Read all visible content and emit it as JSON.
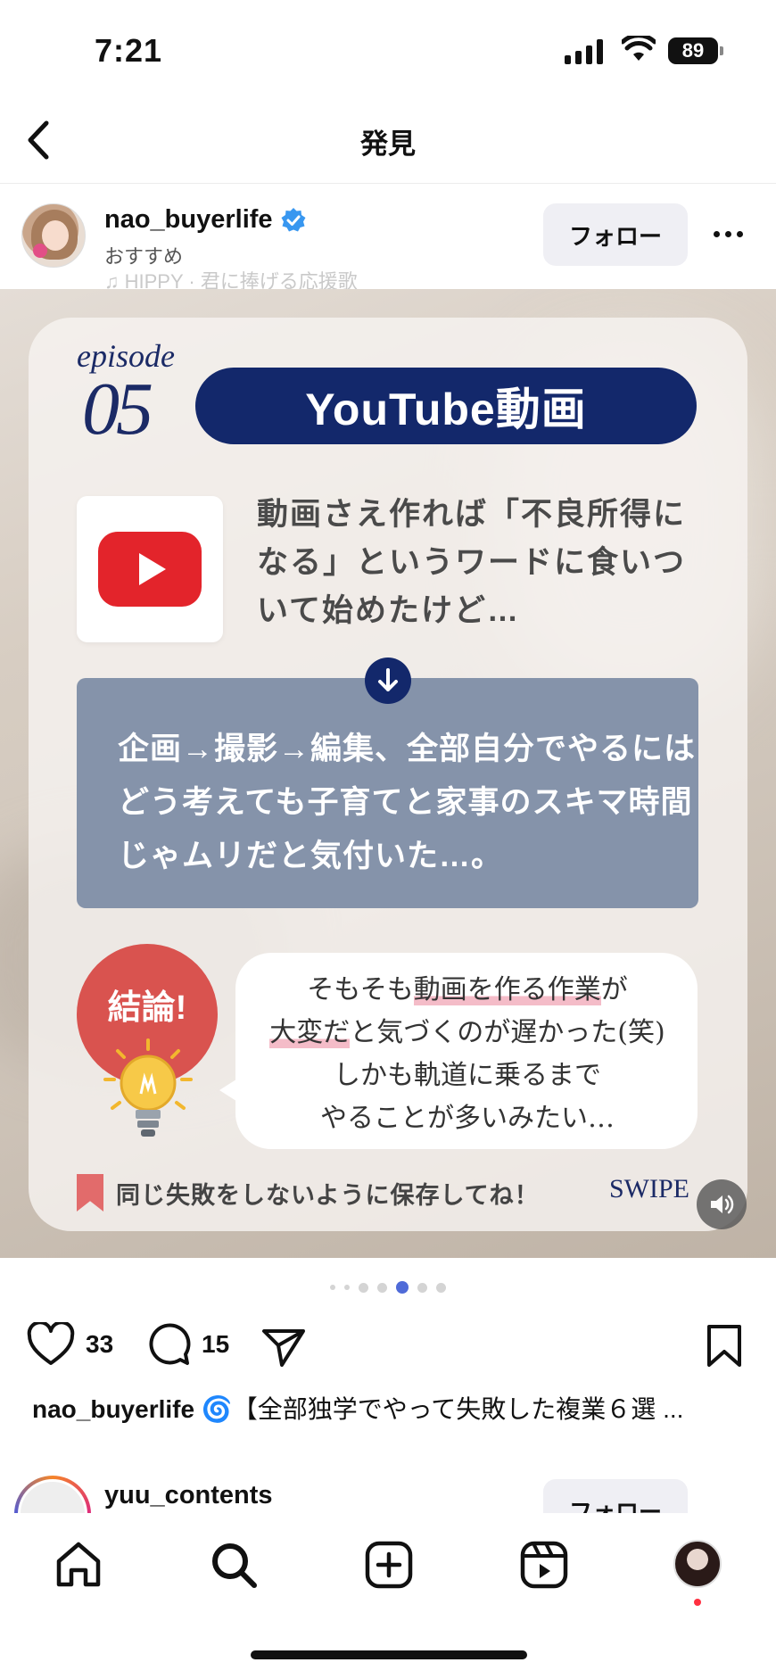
{
  "status_bar": {
    "time": "7:21",
    "battery": "89"
  },
  "nav": {
    "title": "発見"
  },
  "post": {
    "username": "nao_buyerlife",
    "subtitle": "おすすめ",
    "music": "♫ HIPPY · 君に捧げる応援歌",
    "follow_label": "フォロー",
    "image": {
      "episode_word": "episode",
      "episode_num": "05",
      "pill_title": "YouTube動画",
      "desc": "動画さえ作れば「不良所得になる」というワードに食いついて始めたけど…",
      "box_text": "企画→撮影→編集、全部自分でやるにはどう考えても子育てと家事のスキマ時間じゃムリだと気付いた…。",
      "conclusion": "結論!",
      "bubble_line1_a": "そもそも",
      "bubble_line1_hl": "動画を作る作業",
      "bubble_line1_b": "が",
      "bubble_line2_hl": "大変だ",
      "bubble_line2_b": "と気づくのが遅かった(笑)",
      "bubble_line3": "しかも軌道に乗るまで",
      "bubble_line4": "やることが多いみたい…",
      "save_note": "同じ失敗をしないように保存してね！",
      "swipe": "SWIPE"
    },
    "likes": "33",
    "comments": "15",
    "caption_user": "nao_buyerlife",
    "caption_text": " 🌀【全部独学でやって失敗した複業６選 ..."
  },
  "carousel": {
    "total": 7,
    "active_index": 4
  },
  "next_post": {
    "username": "yuu_contents",
    "follow_label": "フォロー"
  },
  "colors": {
    "navy": "#13286b",
    "youtube_red": "#e3242b",
    "box_gray_blue": "#8593aa",
    "conclusion_red": "#d9534f",
    "carousel_active": "#4f6bd8"
  },
  "icons": {
    "back": "chevron-left-icon",
    "verified": "verified-badge-icon",
    "more": "more-horizontal-icon",
    "like": "heart-icon",
    "comment": "comment-icon",
    "share": "send-icon",
    "save": "bookmark-icon",
    "sound": "speaker-icon",
    "home": "home-icon",
    "search": "search-icon",
    "create": "plus-square-icon",
    "reels": "reels-icon",
    "profile": "profile-avatar"
  }
}
